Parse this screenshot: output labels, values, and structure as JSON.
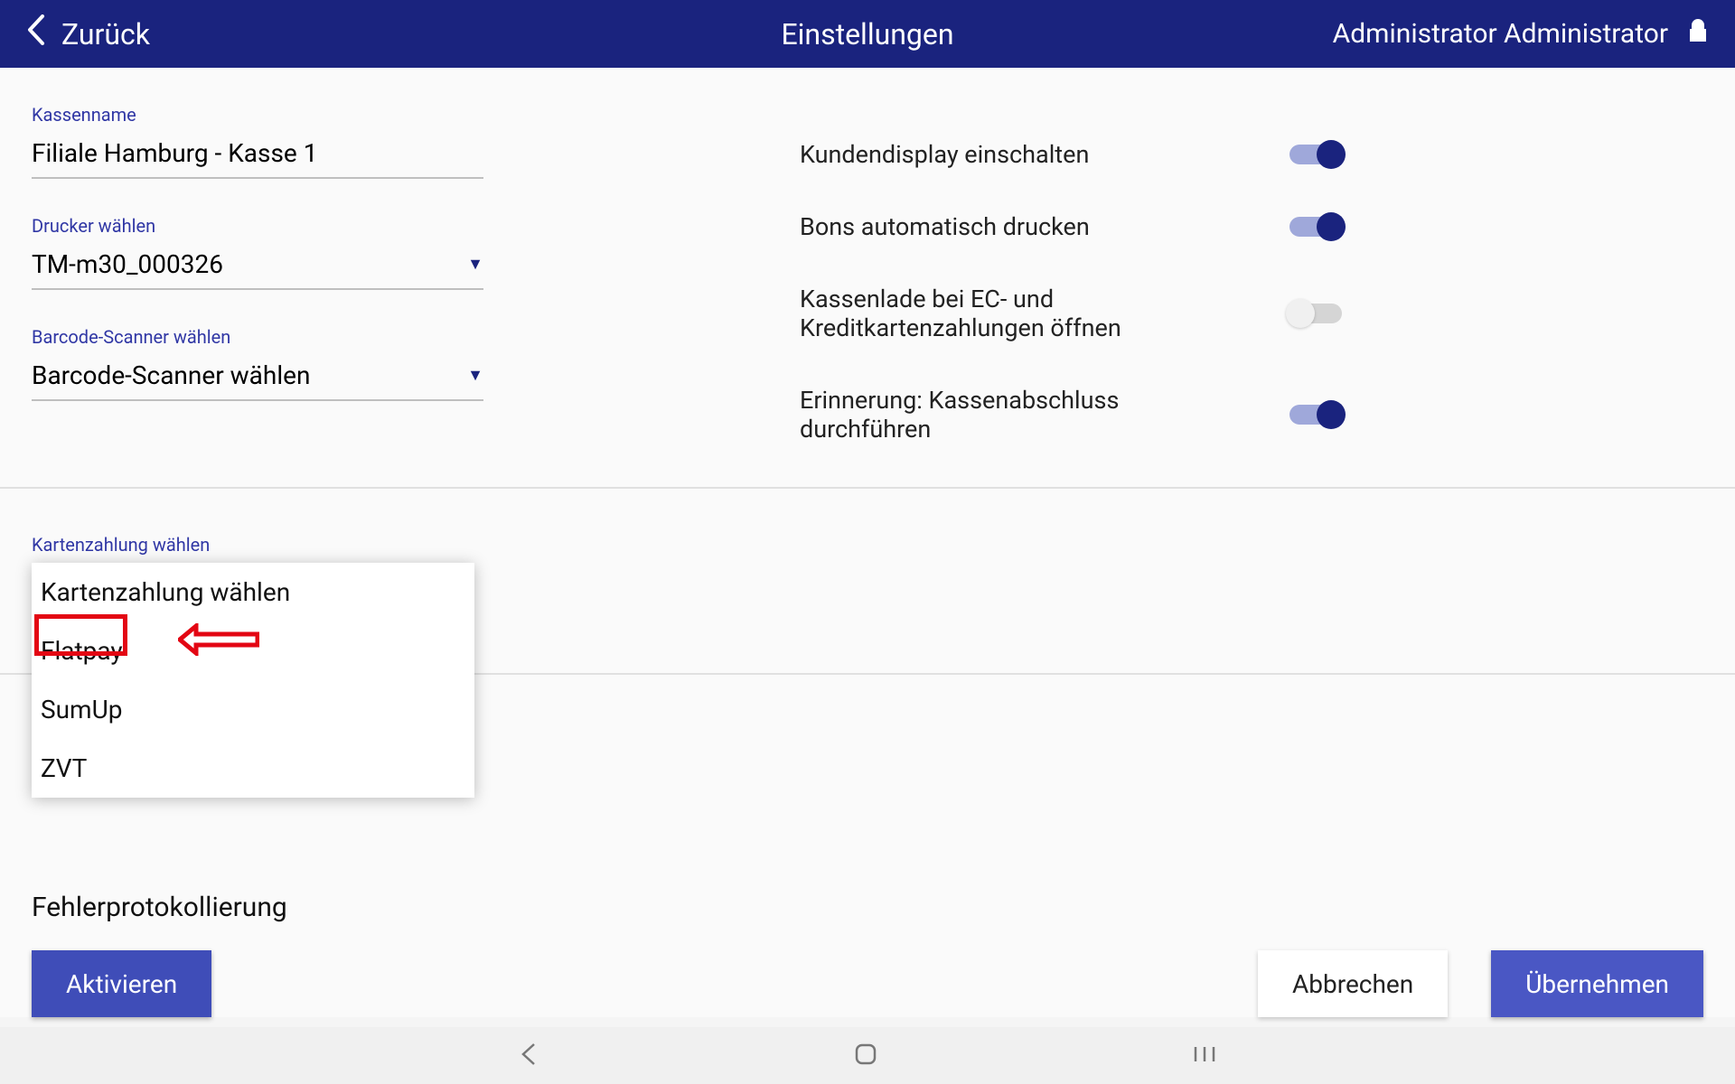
{
  "header": {
    "back_label": "Zurück",
    "title": "Einstellungen",
    "user_name": "Administrator Administrator"
  },
  "fields": {
    "register_name": {
      "label": "Kassenname",
      "value": "Filiale Hamburg - Kasse 1"
    },
    "printer": {
      "label": "Drucker wählen",
      "value": "TM-m30_000326"
    },
    "barcode": {
      "label": "Barcode-Scanner wählen",
      "value": "Barcode-Scanner wählen"
    },
    "card_payment": {
      "label": "Kartenzahlung wählen"
    }
  },
  "toggles": {
    "customer_display": {
      "label": "Kundendisplay einschalten",
      "on": true
    },
    "auto_print": {
      "label": "Bons automatisch drucken",
      "on": true
    },
    "drawer_ec": {
      "label": "Kassenlade bei EC- und Kreditkartenzahlungen öffnen",
      "on": false
    },
    "reminder_close": {
      "label": "Erinnerung: Kassenabschluss durchführen",
      "on": true
    }
  },
  "dropdown_options": {
    "0": "Kartenzahlung wählen",
    "1": "Flatpay",
    "2": "SumUp",
    "3": "ZVT"
  },
  "error_logging": {
    "title": "Fehlerprotokollierung"
  },
  "buttons": {
    "activate": "Aktivieren",
    "cancel": "Abbrechen",
    "apply": "Übernehmen"
  }
}
